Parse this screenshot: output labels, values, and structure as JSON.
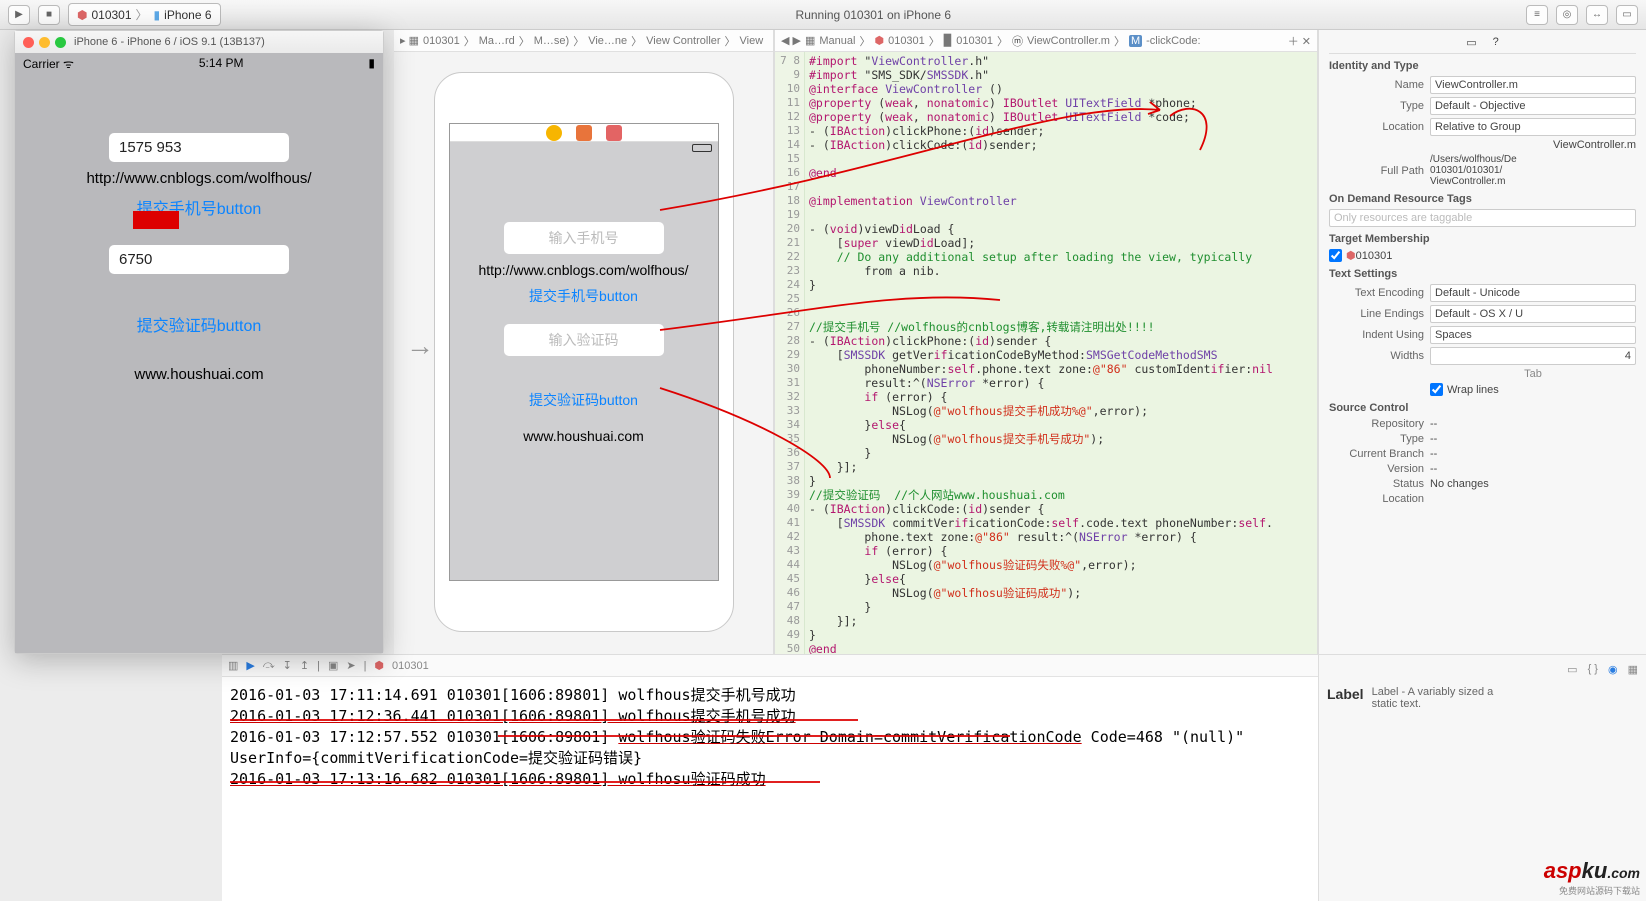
{
  "toolbar": {
    "scheme_target": "010301",
    "scheme_device": "iPhone 6",
    "status_text": "Running 010301 on iPhone 6"
  },
  "simulator": {
    "title": "iPhone 6 - iPhone 6 / iOS 9.1 (13B137)",
    "carrier": "Carrier",
    "time": "5:14 PM",
    "phone_value": "1575        953",
    "url_label": "http://www.cnblogs.com/wolfhous/",
    "submit_phone_btn": "提交手机号button",
    "code_value": "6750",
    "submit_code_btn": "提交验证码button",
    "footer_site": "www.houshuai.com"
  },
  "ib": {
    "crumbs": [
      "010301",
      "Ma…rd",
      "M…se)",
      "Vie…ne",
      "View Controller",
      "View"
    ],
    "ph_phone": "输入手机号",
    "url_label": "http://www.cnblogs.com/wolfhous/",
    "submit_phone_btn": "提交手机号button",
    "ph_code": "输入验证码",
    "submit_code_btn": "提交验证码button",
    "footer_site": "www.houshuai.com"
  },
  "jump": {
    "items": [
      "Manual",
      "010301",
      "010301",
      "ViewController.m",
      "-clickCode:"
    ]
  },
  "code": {
    "lines_start": 7,
    "text": "#import \"ViewController.h\"\n#import \"SMS_SDK/SMSSDK.h\"\n@interface ViewController ()\n@property (weak, nonatomic) IBOutlet UITextField *phone;\n@property (weak, nonatomic) IBOutlet UITextField *code;\n- (IBAction)clickPhone:(id)sender;\n- (IBAction)clickCode:(id)sender;\n\n@end\n\n@implementation ViewController\n\n- (void)viewDidLoad {\n    [super viewDidLoad];\n    // Do any additional setup after loading the view, typically\n        from a nib.\n}\n\n\n//提交手机号 //wolfhous的cnblogs博客,转载请注明出处!!!!\n- (IBAction)clickPhone:(id)sender {\n    [SMSSDK getVerificationCodeByMethod:SMSGetCodeMethodSMS\n        phoneNumber:self.phone.text zone:@\"86\" customIdentifier:nil\n        result:^(NSError *error) {\n        if (error) {\n            NSLog(@\"wolfhous提交手机成功%@\",error);\n        }else{\n            NSLog(@\"wolfhous提交手机号成功\");\n        }\n    }];\n}\n//提交验证码  //个人网站www.houshuai.com\n- (IBAction)clickCode:(id)sender {\n    [SMSSDK commitVerificationCode:self.code.text phoneNumber:self.\n        phone.text zone:@\"86\" result:^(NSError *error) {\n        if (error) {\n            NSLog(@\"wolfhous验证码失败%@\",error);\n        }else{\n            NSLog(@\"wolfhosu验证码成功\");\n        }\n    }];\n}\n@end\n"
  },
  "inspector": {
    "identity_head": "Identity and Type",
    "name_label": "Name",
    "name_value": "ViewController.m",
    "type_label": "Type",
    "type_value": "Default - Objective",
    "loc_label": "Location",
    "loc_value": "Relative to Group",
    "loc_file": "ViewController.m",
    "fullpath_label": "Full Path",
    "fullpath_value": "/Users/wolfhous/De\n010301/010301/\nViewController.m",
    "odr_head": "On Demand Resource Tags",
    "odr_placeholder": "Only resources are taggable",
    "tm_head": "Target Membership",
    "tm_target": "010301",
    "ts_head": "Text Settings",
    "enc_label": "Text Encoding",
    "enc_value": "Default - Unicode",
    "le_label": "Line Endings",
    "le_value": "Default - OS X / U",
    "indent_label": "Indent Using",
    "indent_value": "Spaces",
    "widths_label": "Widths",
    "widths_value": "4",
    "tab_label": "Tab",
    "wrap_label": "Wrap lines",
    "sc_head": "Source Control",
    "repo_label": "Repository",
    "repo_value": "--",
    "sctype_label": "Type",
    "sctype_value": "--",
    "branch_label": "Current Branch",
    "branch_value": "--",
    "ver_label": "Version",
    "ver_value": "--",
    "status_label": "Status",
    "status_value": "No changes",
    "locat_label": "Location",
    "locat_value": ""
  },
  "console": {
    "target": "010301",
    "lines": [
      "2016-01-03 17:11:14.691 010301[1606:89801] wolfhous提交手机号成功",
      "2016-01-03 17:12:36.441 010301[1606:89801] wolfhous提交手机号成功",
      "2016-01-03 17:12:57.552 010301[1606:89801] wolfhous验证码失败Error Domain=commitVerificationCode Code=468 \"(null)\" UserInfo={commitVerificationCode=提交验证码错误}",
      "2016-01-03 17:13:16.682 010301[1606:89801] wolfhosu验证码成功"
    ]
  },
  "library": {
    "title": "Label",
    "desc": "Label - A variably sized a\nstatic text."
  },
  "watermark": {
    "t1": "asp",
    "t2": "ku",
    "t3": ".com",
    "sub": "免费网站源码下载站"
  }
}
